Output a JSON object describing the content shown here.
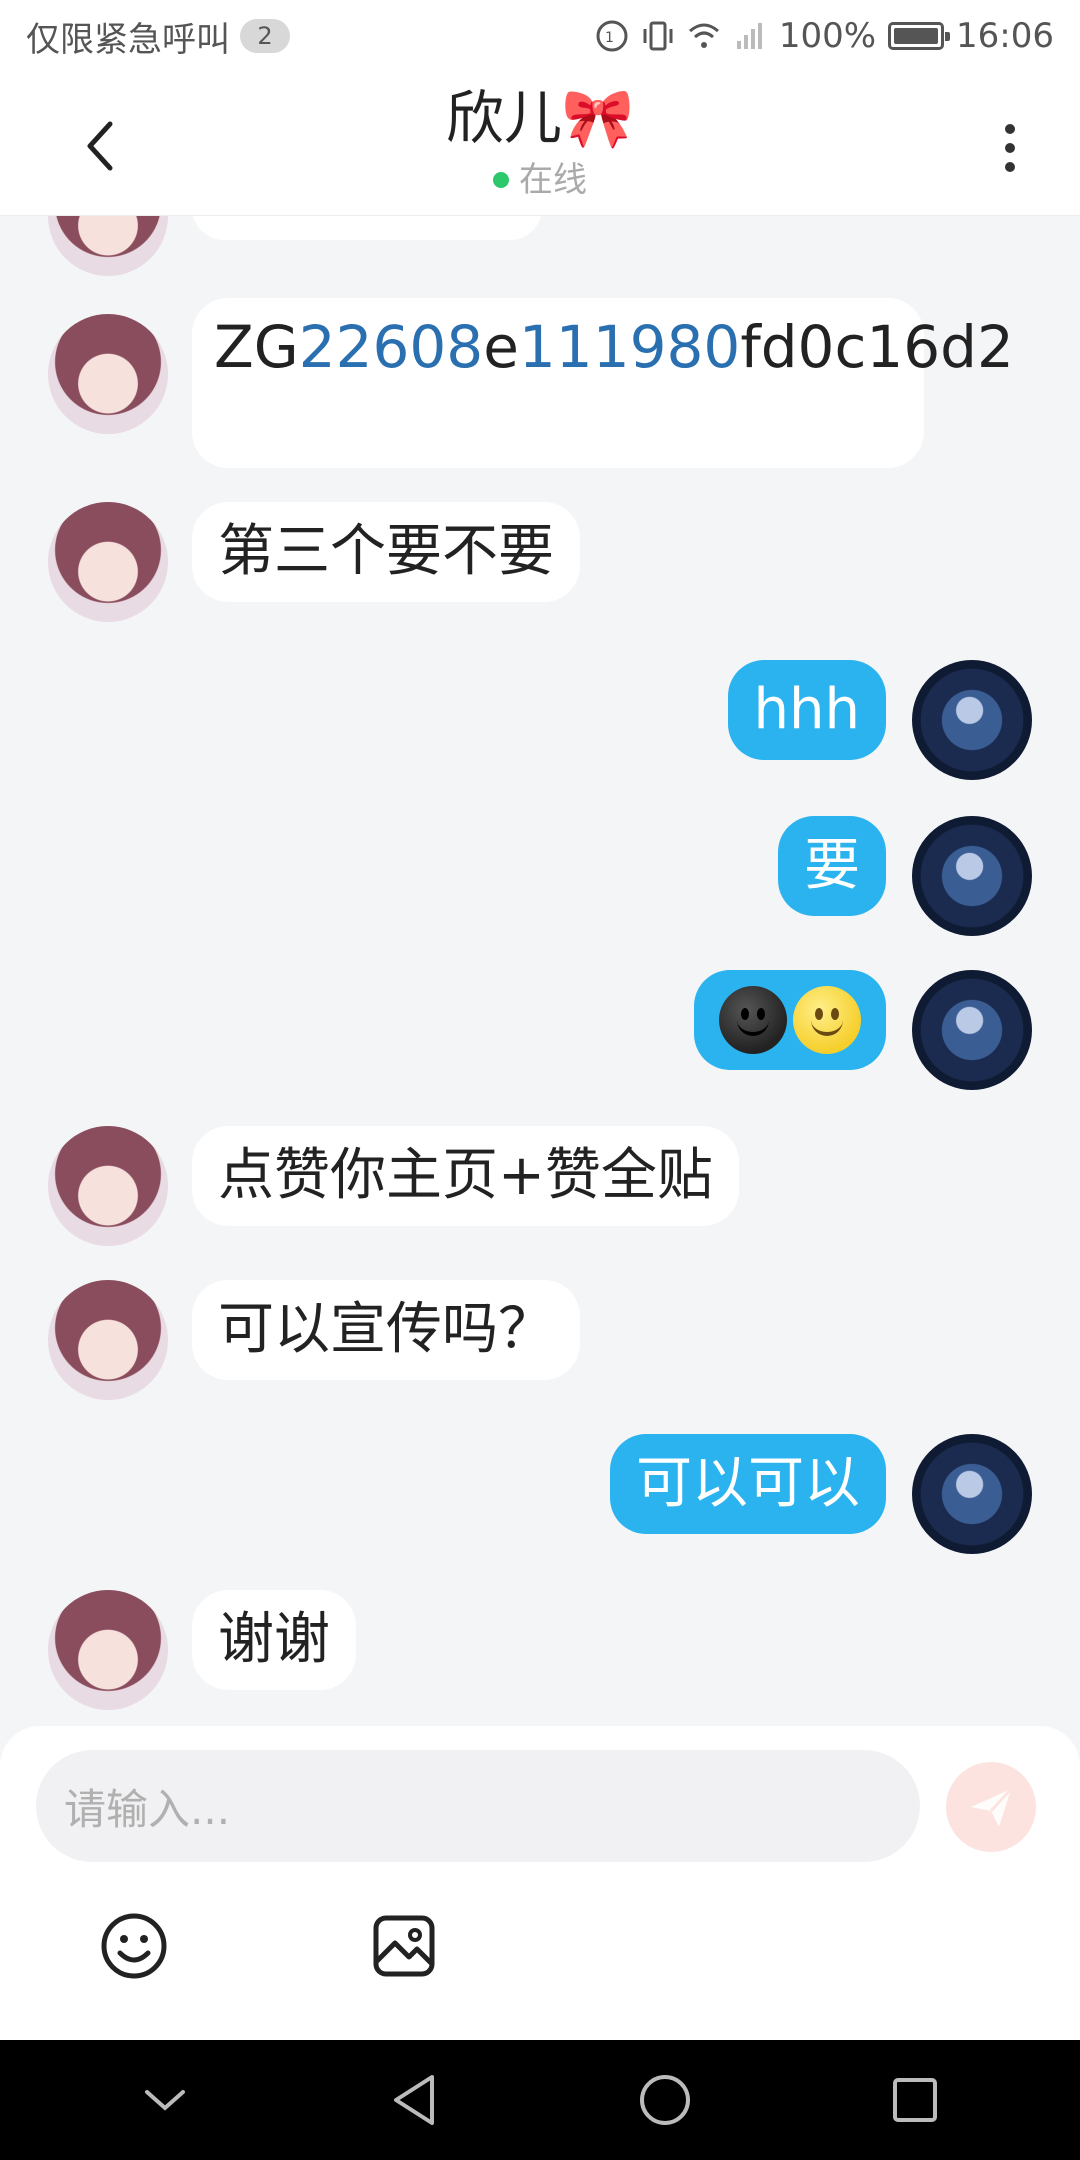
{
  "statusbar": {
    "carrier_text": "仅限紧急呼叫",
    "badge": "2",
    "battery": "100%",
    "time": "16:06"
  },
  "header": {
    "title": "欣儿🎀",
    "status": "在线"
  },
  "messages": [
    {
      "side": "in",
      "text": "第三个要不要"
    },
    {
      "side": "out",
      "text": "hhh"
    },
    {
      "side": "out",
      "text": "要"
    },
    {
      "side": "out",
      "emojis": [
        "dark-smiley-icon",
        "smiley-icon"
      ]
    },
    {
      "side": "in",
      "text": "点赞你主页+赞全贴"
    },
    {
      "side": "in",
      "text": "可以宣传吗？"
    },
    {
      "side": "out",
      "text": "可以可以"
    },
    {
      "side": "in",
      "text": "谢谢"
    }
  ],
  "code_message": {
    "parts": [
      "ZG",
      "22608",
      "e",
      "111980",
      "fd0c16",
      "d2"
    ]
  },
  "composer": {
    "placeholder": "请输入..."
  },
  "colors": {
    "outgoing_bubble": "#2ab3ee",
    "incoming_bubble": "#ffffff",
    "online": "#2dc86b",
    "link_blue": "#2a6fb0"
  }
}
